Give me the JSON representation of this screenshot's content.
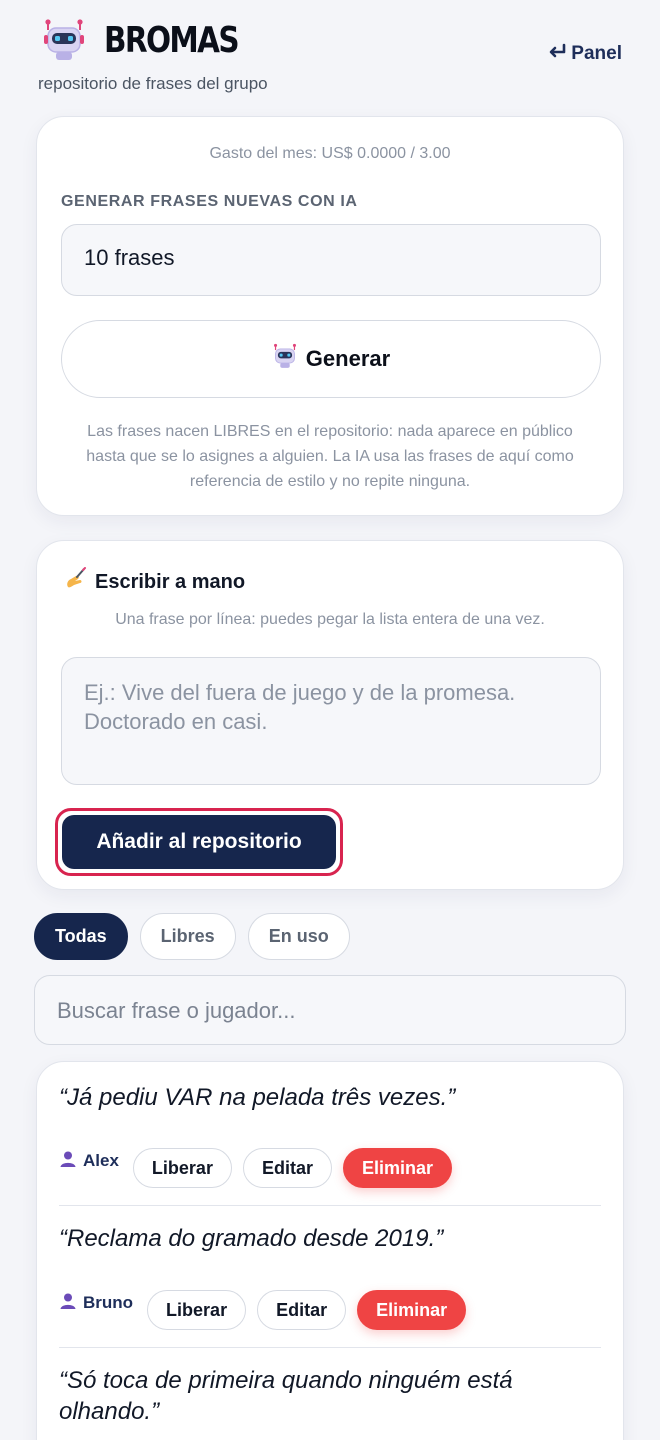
{
  "header": {
    "brand": "BROMAS",
    "subtitle": "repositorio de frases del grupo",
    "panel_link": "Panel",
    "panel_icon": "return-arrow-icon",
    "logo_icon": "robot-icon"
  },
  "ai_card": {
    "spend": "Gasto del mes: US$ 0.0000 / 3.00",
    "section_label": "GENERAR FRASES NUEVAS CON IA",
    "count_value": "10 frases",
    "generate_label": "Generar",
    "note": "Las frases nacen LIBRES en el repositorio: nada aparece en público hasta que se lo asignes a alguien. La IA usa las frases de aquí como referencia de estilo y no repite ninguna."
  },
  "manual_card": {
    "title": "Escribir a mano",
    "hint": "Una frase por línea: puedes pegar la lista entera de una vez.",
    "placeholder": "Ej.: Vive del fuera de juego y de la promesa. Doctorado en casi.",
    "add_label": "Añadir al repositorio"
  },
  "filters": [
    {
      "label": "Todas",
      "active": true
    },
    {
      "label": "Libres",
      "active": false
    },
    {
      "label": "En uso",
      "active": false
    }
  ],
  "search": {
    "placeholder": "Buscar frase o jugador..."
  },
  "phrases": [
    {
      "text": "“Já pediu VAR na pelada três vezes.”",
      "player": "Alex",
      "release": "Liberar",
      "edit": "Editar",
      "delete": "Eliminar"
    },
    {
      "text": "“Reclama do gramado desde 2019.”",
      "player": "Bruno",
      "release": "Liberar",
      "edit": "Editar",
      "delete": "Eliminar"
    },
    {
      "text": "“Só toca de primeira quando ninguém está olhando.”"
    }
  ],
  "colors": {
    "navy": "#16264d",
    "danger": "#ef4444",
    "focus_ring": "#d8244f",
    "background": "#f4f5f9"
  }
}
